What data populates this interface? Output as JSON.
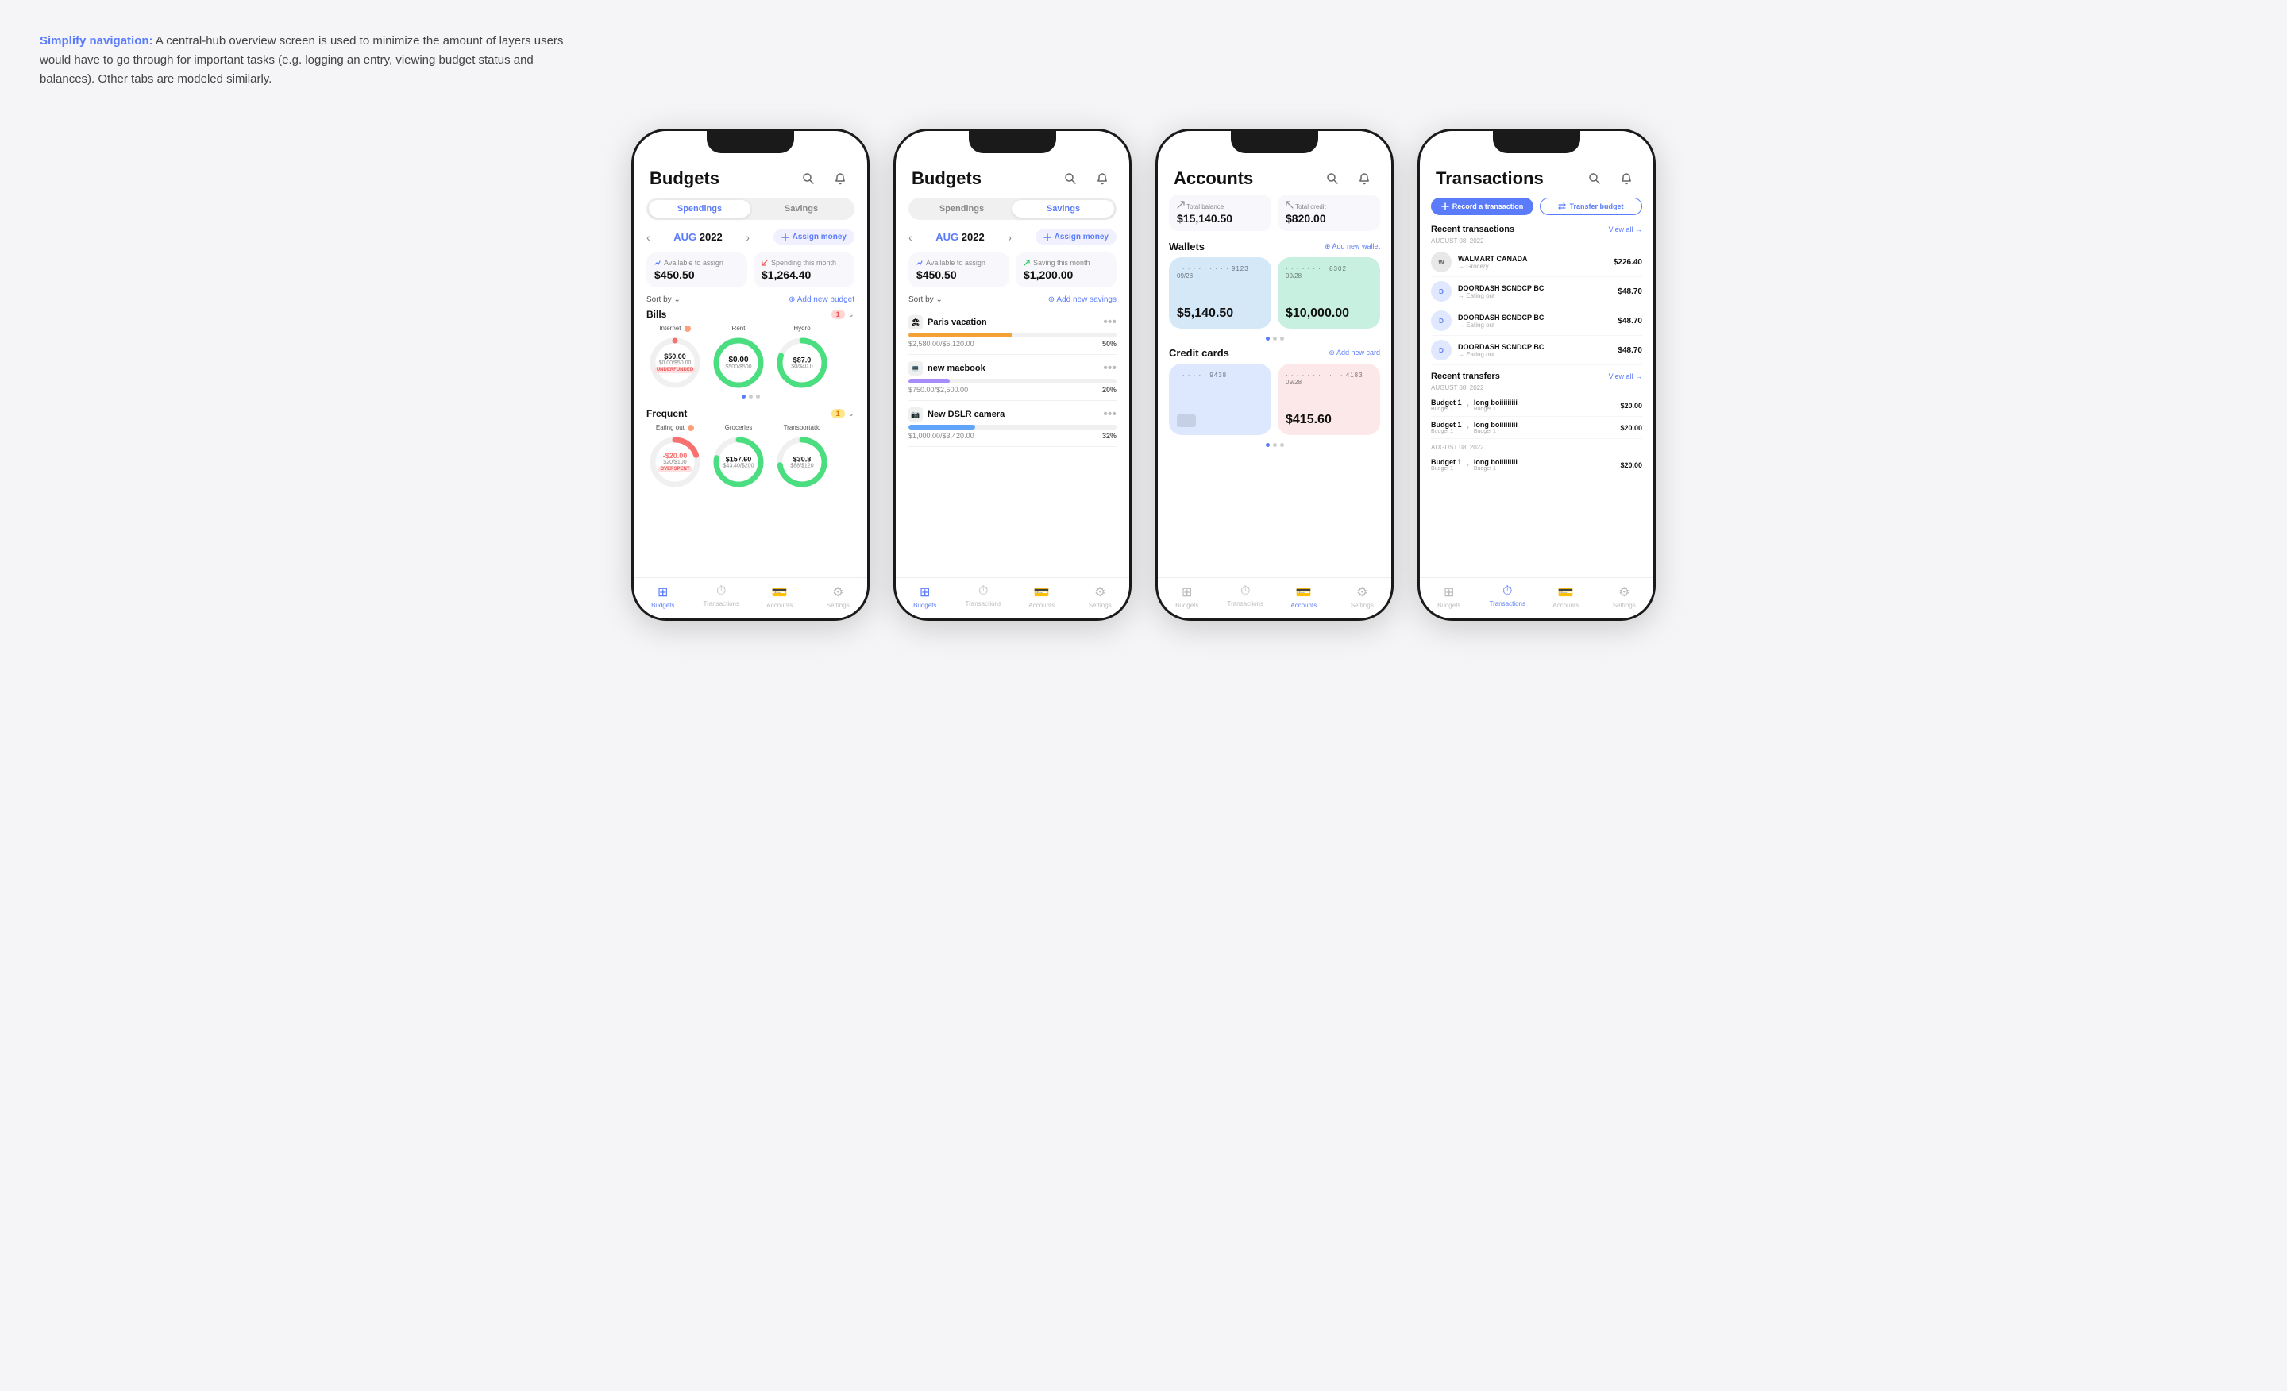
{
  "intro": {
    "highlight": "Simplify navigation:",
    "text": " A central-hub overview screen is used to minimize the amount of layers users would have to go through for important tasks (e.g. logging an entry, viewing budget status and balances). Other tabs are modeled similarly."
  },
  "phones": [
    {
      "id": "phone-budgets-spendings",
      "title": "Budgets",
      "tabs": [
        "Spendings",
        "Savings"
      ],
      "active_tab": "Spendings",
      "month": {
        "label": "AUG",
        "year": "2022"
      },
      "assign_btn": "Assign money",
      "summary": [
        {
          "label": "Available to assign",
          "value": "$450.50",
          "icon": "pencil"
        },
        {
          "label": "Spending this month",
          "value": "$1,264.40",
          "icon": "arrow"
        }
      ],
      "sort_label": "Sort by",
      "add_label": "Add new budget",
      "categories": [
        {
          "name": "Bills",
          "badge": "1",
          "items": [
            {
              "name": "Internet",
              "amount": "$50.00",
              "sub": "$0.00/$50.00",
              "color": "#f87171",
              "pct": 0,
              "badge": "UNDERFUNDED"
            },
            {
              "name": "Rent",
              "amount": "$0.00",
              "sub": "$500.00/$500.00",
              "color": "#4ade80",
              "pct": 100,
              "badge": ""
            },
            {
              "name": "Hydro",
              "amount": "$87.0",
              "sub": "$0.00/$40.0",
              "color": "#4ade80",
              "pct": 80,
              "badge": ""
            }
          ]
        },
        {
          "name": "Frequent",
          "badge": "1",
          "items": [
            {
              "name": "Eating out",
              "amount": "-$20.00",
              "sub": "$20.00/$100.00",
              "color": "#f87171",
              "pct": 20,
              "badge": "OVERSPENT"
            },
            {
              "name": "Groceries",
              "amount": "$157.60",
              "sub": "$43.40/$200.00",
              "color": "#4ade80",
              "pct": 78,
              "badge": ""
            },
            {
              "name": "Transportatio",
              "amount": "$30.8",
              "sub": "$88.00/$120",
              "color": "#4ade80",
              "pct": 73,
              "badge": ""
            }
          ]
        }
      ],
      "nav": [
        "Budgets",
        "Transactions",
        "Accounts",
        "Settings"
      ],
      "active_nav": "Budgets"
    },
    {
      "id": "phone-budgets-savings",
      "title": "Budgets",
      "tabs": [
        "Spendings",
        "Savings"
      ],
      "active_tab": "Savings",
      "month": {
        "label": "AUG",
        "year": "2022"
      },
      "assign_btn": "Assign money",
      "summary": [
        {
          "label": "Available to assign",
          "value": "$450.50",
          "icon": "pencil"
        },
        {
          "label": "Saving this month",
          "value": "$1,200.00",
          "icon": "arrow"
        }
      ],
      "sort_label": "Sort by",
      "add_label": "Add new savings",
      "savings_items": [
        {
          "name": "Paris vacation",
          "icon": "🏖",
          "current": "$2,580.00",
          "target": "$5,120.00",
          "pct": 50,
          "color": "#f4a237"
        },
        {
          "name": "new macbook",
          "icon": "💻",
          "current": "$750.00",
          "target": "$2,500.00",
          "pct": 20,
          "color": "#a78bfa"
        },
        {
          "name": "New DSLR camera",
          "icon": "📷",
          "current": "$1,000.00",
          "target": "$3,420.00",
          "pct": 32,
          "color": "#60a5fa"
        }
      ],
      "nav": [
        "Budgets",
        "Transactions",
        "Accounts",
        "Settings"
      ],
      "active_nav": "Budgets"
    },
    {
      "id": "phone-accounts",
      "title": "Accounts",
      "total_balance_label": "Total balance",
      "total_balance": "$15,140.50",
      "total_credit_label": "Total credit",
      "total_credit": "$820.00",
      "wallets_title": "Wallets",
      "add_wallet": "Add new wallet",
      "wallets": [
        {
          "last4": "9123",
          "date": "09/28",
          "balance": "$5,140.50",
          "color": "#d4e8f8"
        },
        {
          "last4": "8302",
          "date": "09/28",
          "balance": "$10,000.00",
          "color": "#c8f0e0"
        }
      ],
      "credit_title": "Credit cards",
      "add_card": "Add new card",
      "credit_cards": [
        {
          "last4": "9438",
          "date": "",
          "balance": "",
          "color": "#dde8ff"
        },
        {
          "last4": "4183",
          "date": "09/28",
          "balance": "$415.60",
          "color": "#fce8e8"
        }
      ],
      "nav": [
        "Budgets",
        "Transactions",
        "Accounts",
        "Settings"
      ],
      "active_nav": "Accounts"
    },
    {
      "id": "phone-transactions",
      "title": "Transactions",
      "record_btn": "Record a transaction",
      "transfer_btn": "Transfer budget",
      "recent_trans_title": "Recent transactions",
      "view_all_trans": "View all →",
      "trans_date": "AUGUST 08, 2022",
      "transactions": [
        {
          "name": "WALMART CANADA",
          "category": "Grocery",
          "amount": "$226.40",
          "initials": "W"
        },
        {
          "name": "DOORDASH SCNDCP BC",
          "category": "Eating out",
          "amount": "$48.70",
          "initials": "D"
        },
        {
          "name": "DOORDASH SCNDCP BC",
          "category": "Eating out",
          "amount": "$48.70",
          "initials": "D"
        },
        {
          "name": "DOORDASH SCNDCP BC",
          "category": "Eating out",
          "amount": "$48.70",
          "initials": "D"
        }
      ],
      "recent_transfers_title": "Recent transfers",
      "view_all_transfers": "View all →",
      "transfers_date": "AUGUST 08, 2022",
      "transfers": [
        {
          "from": "Budget 1",
          "from_sub": "Budget 1",
          "to": "long boiiiiiiiii",
          "to_sub": "Budget 1",
          "amount": "$20.00"
        },
        {
          "from": "Budget 1",
          "from_sub": "Budget 1",
          "to": "long boiiiiiiiii",
          "to_sub": "Budget 1",
          "amount": "$20.00"
        },
        {
          "from": "Budget 1",
          "from_sub": "Budget 1",
          "to": "long boiiiiiiiii",
          "to_sub": "Budget 1",
          "amount": "$20.00"
        }
      ],
      "transfers_date2": "AUGUST 08, 2022",
      "nav": [
        "Budgets",
        "Transactions",
        "Accounts",
        "Settings"
      ],
      "active_nav": "Transactions"
    }
  ]
}
